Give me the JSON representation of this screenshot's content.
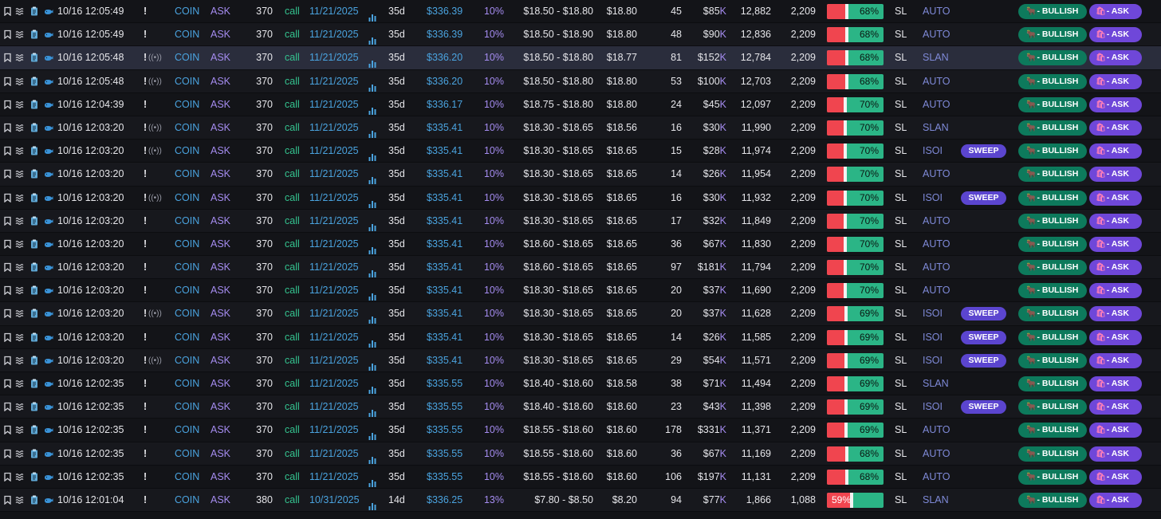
{
  "badges": {
    "sweep": "SWEEP",
    "sentiment": "- BULLISH",
    "side_tag": "- ASK",
    "sentiment_glyph": "🐂",
    "side_glyph": "🛍",
    "signal_glyph": "((•))"
  },
  "icons": [
    "bookmark-icon",
    "waves-icon",
    "clipboard-icon",
    "whale-icon",
    "bars-chart-icon"
  ],
  "colors": {
    "ticker": "#4aa3df",
    "side": "#a58cf0",
    "call": "#34c38f",
    "bar_red": "#f0454f",
    "bar_green": "#2bb586",
    "sweep": "#5b45cf",
    "bullish": "#0d7a5c",
    "ask_pill": "#6f47d9"
  },
  "rows": [
    {
      "time": "10/16 12:05:49",
      "flag": "!",
      "ticker": "COIN",
      "side": "ASK",
      "strike": "370",
      "type": "call",
      "expiry": "11/21/2025",
      "dte": "35d",
      "spot": "$336.39",
      "otm": "10%",
      "range": "$18.50 - $18.80",
      "price": "$18.80",
      "size": "45",
      "prem": "$85",
      "prem_unit": "K",
      "vol": "12,882",
      "oi": "2,209",
      "pct": "68%",
      "pct_value": 68,
      "cond": "SL",
      "exch": "AUTO"
    },
    {
      "time": "10/16 12:05:49",
      "flag": "!",
      "ticker": "COIN",
      "side": "ASK",
      "strike": "370",
      "type": "call",
      "expiry": "11/21/2025",
      "dte": "35d",
      "spot": "$336.39",
      "otm": "10%",
      "range": "$18.50 - $18.90",
      "price": "$18.80",
      "size": "48",
      "prem": "$90",
      "prem_unit": "K",
      "vol": "12,836",
      "oi": "2,209",
      "pct": "68%",
      "pct_value": 68,
      "cond": "SL",
      "exch": "AUTO"
    },
    {
      "time": "10/16 12:05:48",
      "flag": "!",
      "signal": true,
      "highlight": true,
      "ticker": "COIN",
      "side": "ASK",
      "strike": "370",
      "type": "call",
      "expiry": "11/21/2025",
      "dte": "35d",
      "spot": "$336.20",
      "otm": "10%",
      "range": "$18.50 - $18.80",
      "price": "$18.77",
      "size": "81",
      "prem": "$152",
      "prem_unit": "K",
      "vol": "12,784",
      "oi": "2,209",
      "pct": "68%",
      "pct_value": 68,
      "cond": "SL",
      "exch": "SLAN"
    },
    {
      "time": "10/16 12:05:48",
      "flag": "!",
      "signal": true,
      "ticker": "COIN",
      "side": "ASK",
      "strike": "370",
      "type": "call",
      "expiry": "11/21/2025",
      "dte": "35d",
      "spot": "$336.20",
      "otm": "10%",
      "range": "$18.50 - $18.80",
      "price": "$18.80",
      "size": "53",
      "prem": "$100",
      "prem_unit": "K",
      "vol": "12,703",
      "oi": "2,209",
      "pct": "68%",
      "pct_value": 68,
      "cond": "SL",
      "exch": "AUTO"
    },
    {
      "time": "10/16 12:04:39",
      "flag": "!",
      "ticker": "COIN",
      "side": "ASK",
      "strike": "370",
      "type": "call",
      "expiry": "11/21/2025",
      "dte": "35d",
      "spot": "$336.17",
      "otm": "10%",
      "range": "$18.75 - $18.80",
      "price": "$18.80",
      "size": "24",
      "prem": "$45",
      "prem_unit": "K",
      "vol": "12,097",
      "oi": "2,209",
      "pct": "70%",
      "pct_value": 70,
      "cond": "SL",
      "exch": "AUTO"
    },
    {
      "time": "10/16 12:03:20",
      "flag": "!",
      "signal": true,
      "ticker": "COIN",
      "side": "ASK",
      "strike": "370",
      "type": "call",
      "expiry": "11/21/2025",
      "dte": "35d",
      "spot": "$335.41",
      "otm": "10%",
      "range": "$18.30 - $18.65",
      "price": "$18.56",
      "size": "16",
      "prem": "$30",
      "prem_unit": "K",
      "vol": "11,990",
      "oi": "2,209",
      "pct": "70%",
      "pct_value": 70,
      "cond": "SL",
      "exch": "SLAN"
    },
    {
      "time": "10/16 12:03:20",
      "flag": "!",
      "signal": true,
      "ticker": "COIN",
      "side": "ASK",
      "strike": "370",
      "type": "call",
      "expiry": "11/21/2025",
      "dte": "35d",
      "spot": "$335.41",
      "otm": "10%",
      "range": "$18.30 - $18.65",
      "price": "$18.65",
      "size": "15",
      "prem": "$28",
      "prem_unit": "K",
      "vol": "11,974",
      "oi": "2,209",
      "pct": "70%",
      "pct_value": 70,
      "cond": "SL",
      "exch": "ISOI",
      "sweep": true
    },
    {
      "time": "10/16 12:03:20",
      "flag": "!",
      "ticker": "COIN",
      "side": "ASK",
      "strike": "370",
      "type": "call",
      "expiry": "11/21/2025",
      "dte": "35d",
      "spot": "$335.41",
      "otm": "10%",
      "range": "$18.30 - $18.65",
      "price": "$18.65",
      "size": "14",
      "prem": "$26",
      "prem_unit": "K",
      "vol": "11,954",
      "oi": "2,209",
      "pct": "70%",
      "pct_value": 70,
      "cond": "SL",
      "exch": "AUTO"
    },
    {
      "time": "10/16 12:03:20",
      "flag": "!",
      "signal": true,
      "ticker": "COIN",
      "side": "ASK",
      "strike": "370",
      "type": "call",
      "expiry": "11/21/2025",
      "dte": "35d",
      "spot": "$335.41",
      "otm": "10%",
      "range": "$18.30 - $18.65",
      "price": "$18.65",
      "size": "16",
      "prem": "$30",
      "prem_unit": "K",
      "vol": "11,932",
      "oi": "2,209",
      "pct": "70%",
      "pct_value": 70,
      "cond": "SL",
      "exch": "ISOI",
      "sweep": true
    },
    {
      "time": "10/16 12:03:20",
      "flag": "!",
      "ticker": "COIN",
      "side": "ASK",
      "strike": "370",
      "type": "call",
      "expiry": "11/21/2025",
      "dte": "35d",
      "spot": "$335.41",
      "otm": "10%",
      "range": "$18.30 - $18.65",
      "price": "$18.65",
      "size": "17",
      "prem": "$32",
      "prem_unit": "K",
      "vol": "11,849",
      "oi": "2,209",
      "pct": "70%",
      "pct_value": 70,
      "cond": "SL",
      "exch": "AUTO"
    },
    {
      "time": "10/16 12:03:20",
      "flag": "!",
      "ticker": "COIN",
      "side": "ASK",
      "strike": "370",
      "type": "call",
      "expiry": "11/21/2025",
      "dte": "35d",
      "spot": "$335.41",
      "otm": "10%",
      "range": "$18.60 - $18.65",
      "price": "$18.65",
      "size": "36",
      "prem": "$67",
      "prem_unit": "K",
      "vol": "11,830",
      "oi": "2,209",
      "pct": "70%",
      "pct_value": 70,
      "cond": "SL",
      "exch": "AUTO"
    },
    {
      "time": "10/16 12:03:20",
      "flag": "!",
      "ticker": "COIN",
      "side": "ASK",
      "strike": "370",
      "type": "call",
      "expiry": "11/21/2025",
      "dte": "35d",
      "spot": "$335.41",
      "otm": "10%",
      "range": "$18.60 - $18.65",
      "price": "$18.65",
      "size": "97",
      "prem": "$181",
      "prem_unit": "K",
      "vol": "11,794",
      "oi": "2,209",
      "pct": "70%",
      "pct_value": 70,
      "cond": "SL",
      "exch": "AUTO"
    },
    {
      "time": "10/16 12:03:20",
      "flag": "!",
      "ticker": "COIN",
      "side": "ASK",
      "strike": "370",
      "type": "call",
      "expiry": "11/21/2025",
      "dte": "35d",
      "spot": "$335.41",
      "otm": "10%",
      "range": "$18.30 - $18.65",
      "price": "$18.65",
      "size": "20",
      "prem": "$37",
      "prem_unit": "K",
      "vol": "11,690",
      "oi": "2,209",
      "pct": "70%",
      "pct_value": 70,
      "cond": "SL",
      "exch": "AUTO"
    },
    {
      "time": "10/16 12:03:20",
      "flag": "!",
      "signal": true,
      "ticker": "COIN",
      "side": "ASK",
      "strike": "370",
      "type": "call",
      "expiry": "11/21/2025",
      "dte": "35d",
      "spot": "$335.41",
      "otm": "10%",
      "range": "$18.30 - $18.65",
      "price": "$18.65",
      "size": "20",
      "prem": "$37",
      "prem_unit": "K",
      "vol": "11,628",
      "oi": "2,209",
      "pct": "69%",
      "pct_value": 69,
      "cond": "SL",
      "exch": "ISOI",
      "sweep": true
    },
    {
      "time": "10/16 12:03:20",
      "flag": "!",
      "ticker": "COIN",
      "side": "ASK",
      "strike": "370",
      "type": "call",
      "expiry": "11/21/2025",
      "dte": "35d",
      "spot": "$335.41",
      "otm": "10%",
      "range": "$18.30 - $18.65",
      "price": "$18.65",
      "size": "14",
      "prem": "$26",
      "prem_unit": "K",
      "vol": "11,585",
      "oi": "2,209",
      "pct": "69%",
      "pct_value": 69,
      "cond": "SL",
      "exch": "ISOI",
      "sweep": true
    },
    {
      "time": "10/16 12:03:20",
      "flag": "!",
      "signal": true,
      "ticker": "COIN",
      "side": "ASK",
      "strike": "370",
      "type": "call",
      "expiry": "11/21/2025",
      "dte": "35d",
      "spot": "$335.41",
      "otm": "10%",
      "range": "$18.30 - $18.65",
      "price": "$18.65",
      "size": "29",
      "prem": "$54",
      "prem_unit": "K",
      "vol": "11,571",
      "oi": "2,209",
      "pct": "69%",
      "pct_value": 69,
      "cond": "SL",
      "exch": "ISOI",
      "sweep": true
    },
    {
      "time": "10/16 12:02:35",
      "flag": "!",
      "ticker": "COIN",
      "side": "ASK",
      "strike": "370",
      "type": "call",
      "expiry": "11/21/2025",
      "dte": "35d",
      "spot": "$335.55",
      "otm": "10%",
      "range": "$18.40 - $18.60",
      "price": "$18.58",
      "size": "38",
      "prem": "$71",
      "prem_unit": "K",
      "vol": "11,494",
      "oi": "2,209",
      "pct": "69%",
      "pct_value": 69,
      "cond": "SL",
      "exch": "SLAN"
    },
    {
      "time": "10/16 12:02:35",
      "flag": "!",
      "ticker": "COIN",
      "side": "ASK",
      "strike": "370",
      "type": "call",
      "expiry": "11/21/2025",
      "dte": "35d",
      "spot": "$335.55",
      "otm": "10%",
      "range": "$18.40 - $18.60",
      "price": "$18.60",
      "size": "23",
      "prem": "$43",
      "prem_unit": "K",
      "vol": "11,398",
      "oi": "2,209",
      "pct": "69%",
      "pct_value": 69,
      "cond": "SL",
      "exch": "ISOI",
      "sweep": true
    },
    {
      "time": "10/16 12:02:35",
      "flag": "!",
      "ticker": "COIN",
      "side": "ASK",
      "strike": "370",
      "type": "call",
      "expiry": "11/21/2025",
      "dte": "35d",
      "spot": "$335.55",
      "otm": "10%",
      "range": "$18.55 - $18.60",
      "price": "$18.60",
      "size": "178",
      "prem": "$331",
      "prem_unit": "K",
      "vol": "11,371",
      "oi": "2,209",
      "pct": "69%",
      "pct_value": 69,
      "cond": "SL",
      "exch": "AUTO"
    },
    {
      "time": "10/16 12:02:35",
      "flag": "!",
      "ticker": "COIN",
      "side": "ASK",
      "strike": "370",
      "type": "call",
      "expiry": "11/21/2025",
      "dte": "35d",
      "spot": "$335.55",
      "otm": "10%",
      "range": "$18.55 - $18.60",
      "price": "$18.60",
      "size": "36",
      "prem": "$67",
      "prem_unit": "K",
      "vol": "11,169",
      "oi": "2,209",
      "pct": "68%",
      "pct_value": 68,
      "cond": "SL",
      "exch": "AUTO"
    },
    {
      "time": "10/16 12:02:35",
      "flag": "!",
      "ticker": "COIN",
      "side": "ASK",
      "strike": "370",
      "type": "call",
      "expiry": "11/21/2025",
      "dte": "35d",
      "spot": "$335.55",
      "otm": "10%",
      "range": "$18.55 - $18.60",
      "price": "$18.60",
      "size": "106",
      "prem": "$197",
      "prem_unit": "K",
      "vol": "11,131",
      "oi": "2,209",
      "pct": "68%",
      "pct_value": 68,
      "cond": "SL",
      "exch": "AUTO"
    },
    {
      "time": "10/16 12:01:04",
      "flag": "!",
      "ticker": "COIN",
      "side": "ASK",
      "strike": "380",
      "type": "call",
      "expiry": "10/31/2025",
      "dte": "14d",
      "spot": "$336.25",
      "otm": "13%",
      "range": "$7.80 - $8.50",
      "price": "$8.20",
      "size": "94",
      "prem": "$77",
      "prem_unit": "K",
      "vol": "1,866",
      "oi": "1,088",
      "pct": "59%",
      "pct_value": 59,
      "pct_on_red": true,
      "cond": "SL",
      "exch": "SLAN"
    }
  ]
}
